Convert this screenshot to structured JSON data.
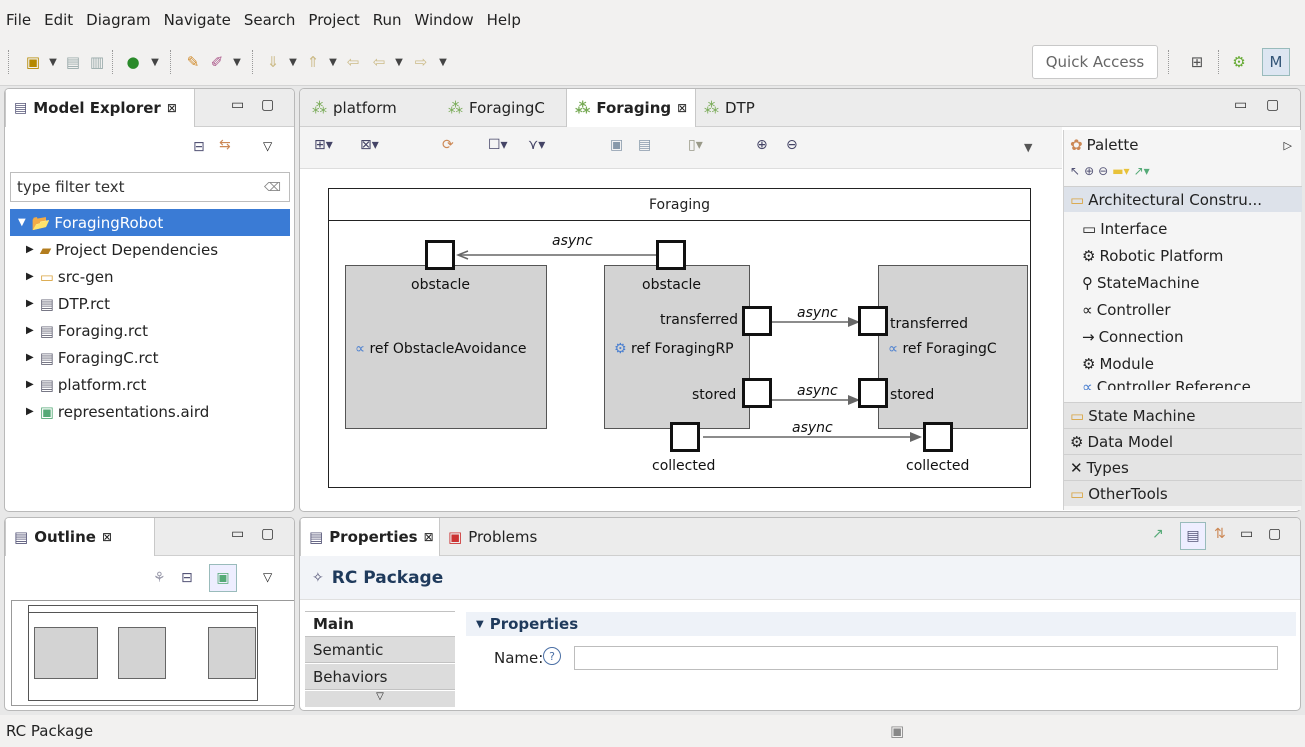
{
  "menu": [
    "File",
    "Edit",
    "Diagram",
    "Navigate",
    "Search",
    "Project",
    "Run",
    "Window",
    "Help"
  ],
  "toolbar": {
    "quick_access": "Quick Access"
  },
  "model_explorer": {
    "title": "Model Explorer",
    "close": "⊠",
    "filter_placeholder": "type filter text",
    "tree": [
      {
        "label": "ForagingRobot",
        "icon": "project-icon",
        "selected": true
      },
      {
        "label": "Project Dependencies",
        "icon": "library-icon"
      },
      {
        "label": "src-gen",
        "icon": "folder-icon"
      },
      {
        "label": "DTP.rct",
        "icon": "file-icon"
      },
      {
        "label": "Foraging.rct",
        "icon": "file-icon"
      },
      {
        "label": "ForagingC.rct",
        "icon": "file-icon"
      },
      {
        "label": "platform.rct",
        "icon": "file-icon"
      },
      {
        "label": "representations.aird",
        "icon": "aird-icon"
      }
    ]
  },
  "editor": {
    "tabs": [
      {
        "label": "platform",
        "active": false
      },
      {
        "label": "ForagingC",
        "active": false
      },
      {
        "label": "Foraging",
        "active": true,
        "close": "⊠"
      },
      {
        "label": "DTP",
        "active": false
      }
    ]
  },
  "diagram": {
    "title": "Foraging",
    "blocks": [
      {
        "ref": "ref ObstacleAvoidance",
        "ports": [
          "obstacle"
        ]
      },
      {
        "ref": "ref ForagingRP",
        "ports": [
          "obstacle",
          "transferred",
          "stored",
          "collected"
        ]
      },
      {
        "ref": "ref ForagingC",
        "ports": [
          "transferred",
          "stored",
          "collected"
        ]
      }
    ],
    "connections": [
      "async",
      "async",
      "async",
      "async"
    ]
  },
  "palette": {
    "title": "Palette",
    "drawers": {
      "architectural": "Architectural Constru...",
      "state_machine": "State Machine",
      "data_model": "Data Model",
      "types": "Types",
      "other_tools": "OtherTools"
    },
    "items": [
      "Interface",
      "Robotic Platform",
      "StateMachine",
      "Controller",
      "Connection",
      "Module",
      "Controller Reference"
    ]
  },
  "outline": {
    "title": "Outline",
    "close": "⊠"
  },
  "properties": {
    "tabs": [
      {
        "label": "Properties",
        "close": "⊠"
      },
      {
        "label": "Problems"
      }
    ],
    "heading": "RC Package",
    "side_tabs": [
      "Main",
      "Semantic",
      "Behaviors"
    ],
    "section": "Properties",
    "name_label": "Name:",
    "name_value": ""
  },
  "status": {
    "text": "RC Package"
  },
  "colors": {
    "selection": "#3a7bd5",
    "block_fill": "#d3d3d3",
    "accent_link": "#1f4e8c"
  }
}
